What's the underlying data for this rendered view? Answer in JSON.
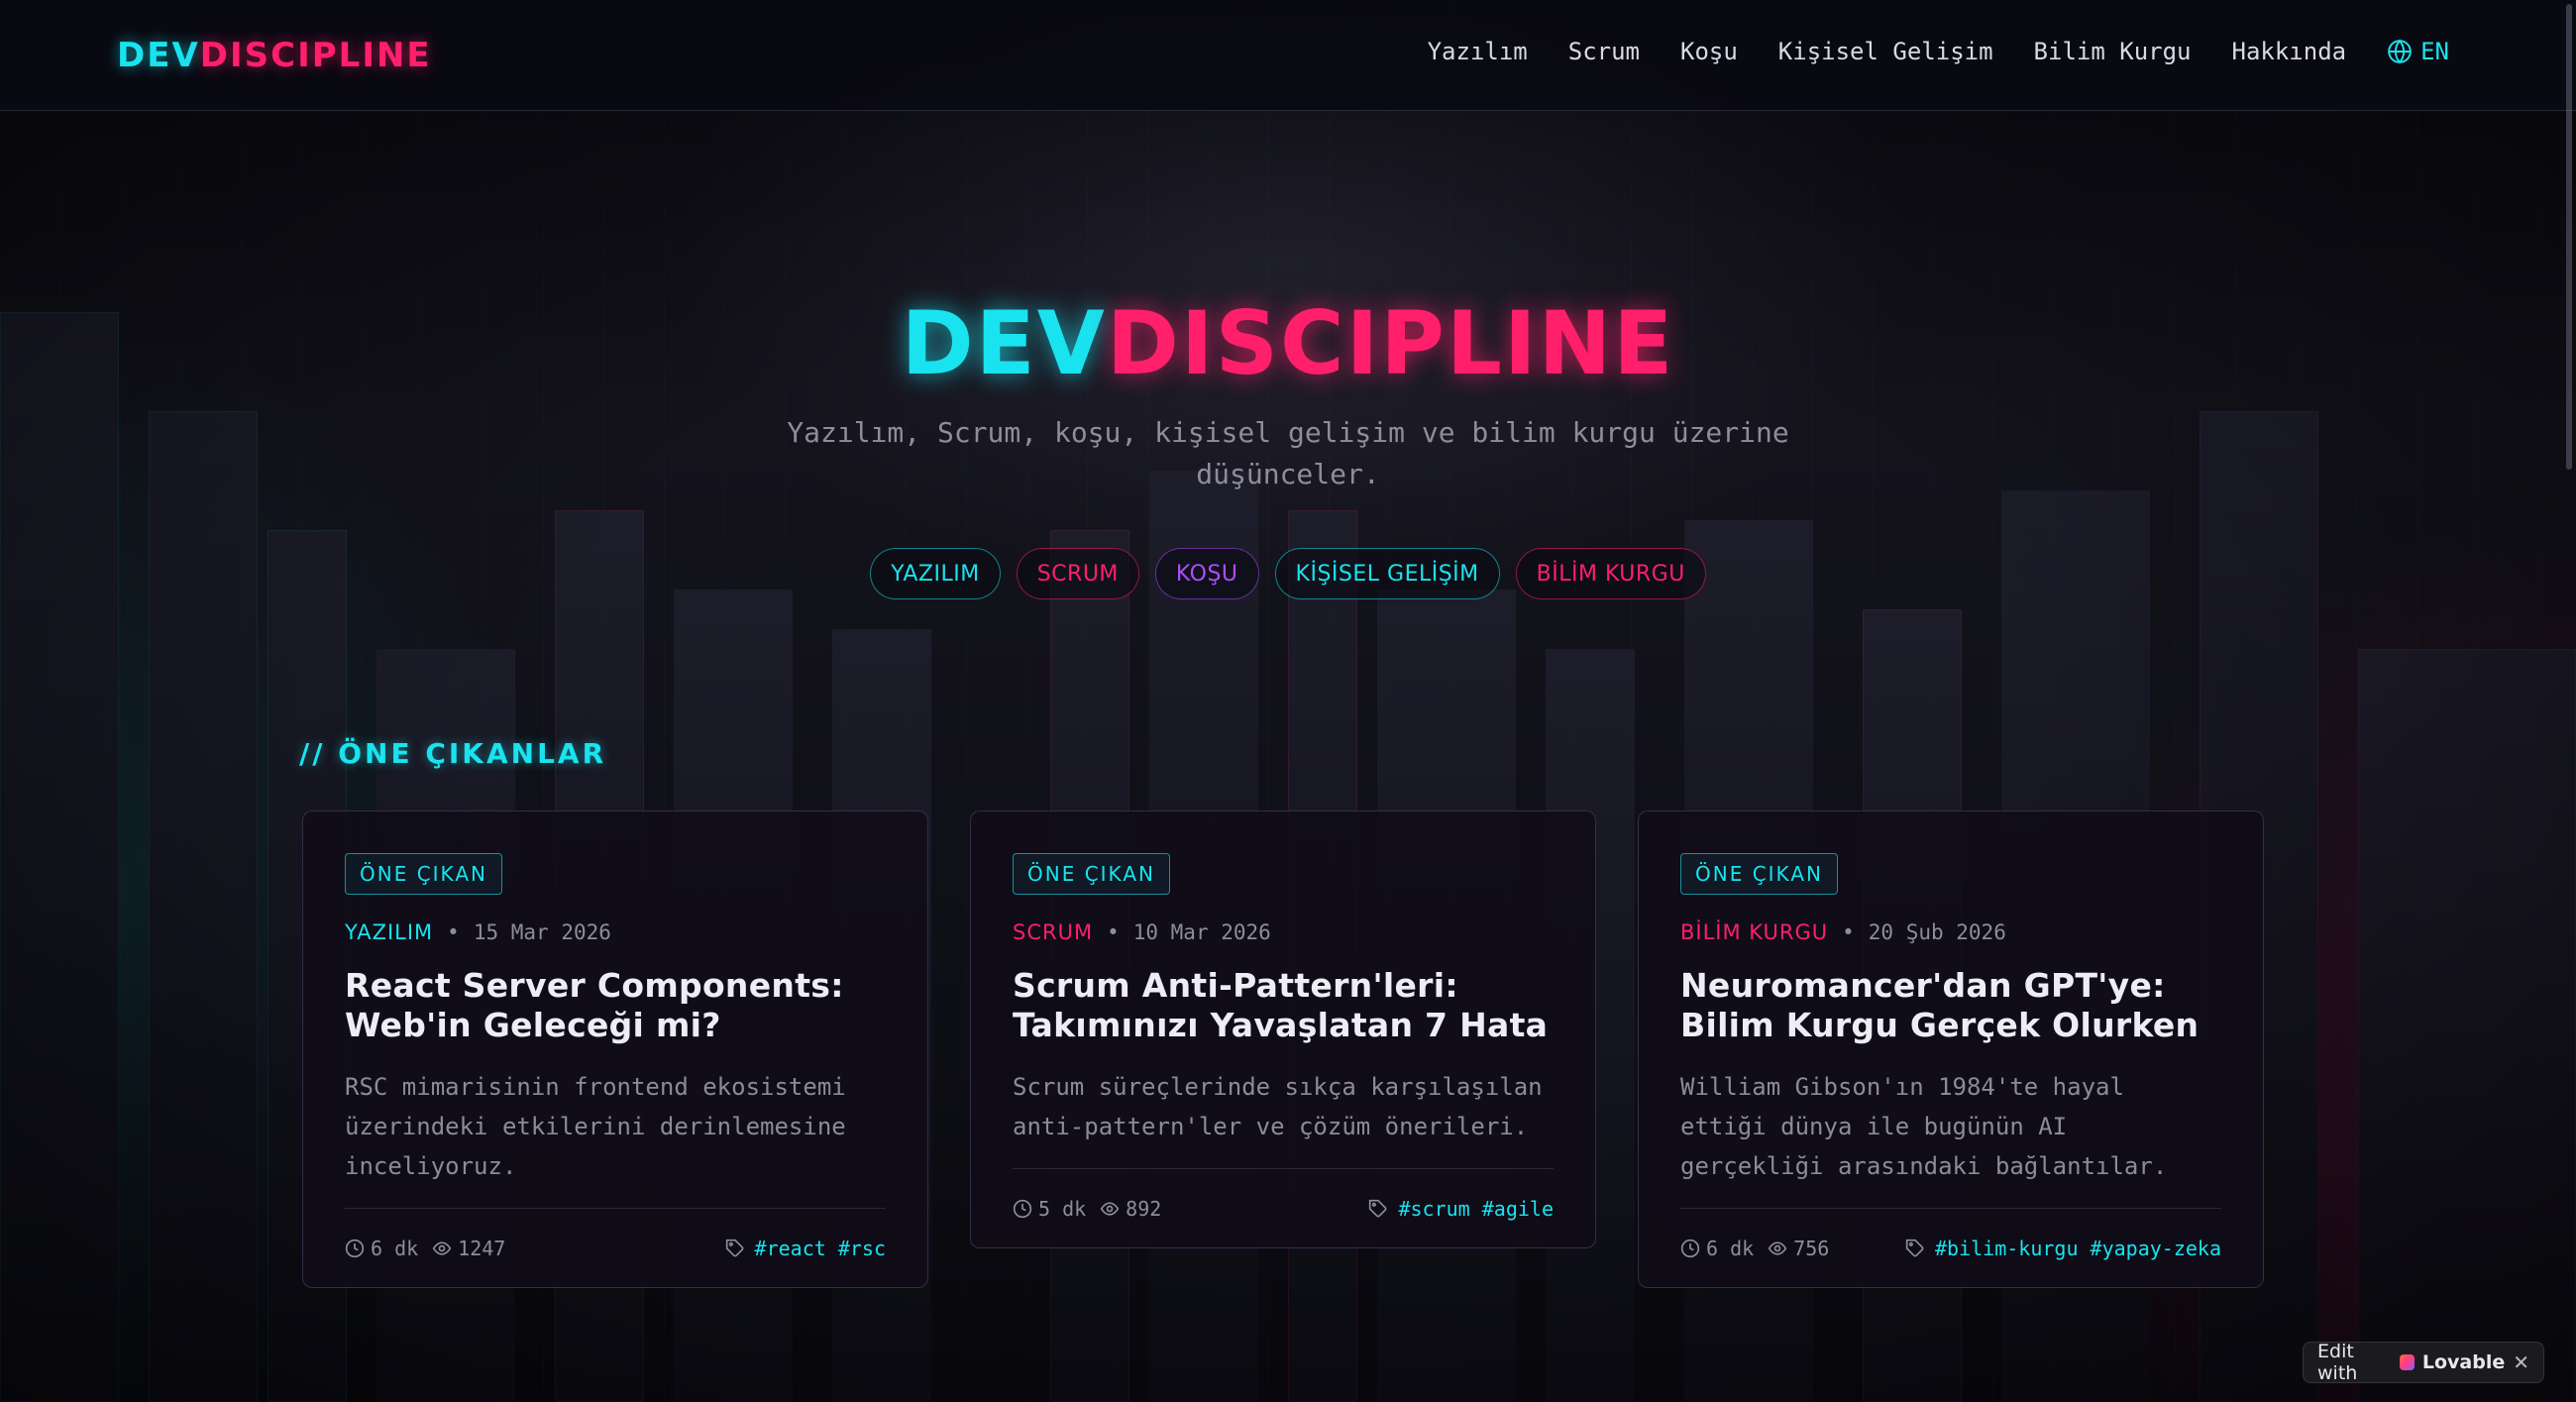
{
  "brand": {
    "part1": "DEV",
    "part2": "DISCIPLINE"
  },
  "nav": {
    "items": [
      "Yazılım",
      "Scrum",
      "Koşu",
      "Kişisel Gelişim",
      "Bilim Kurgu",
      "Hakkında"
    ],
    "language": "EN"
  },
  "hero": {
    "title_part1": "DEV",
    "title_part2": "DISCIPLINE",
    "tagline": "Yazılım, Scrum, koşu, kişisel gelişim ve bilim kurgu üzerine düşünceler."
  },
  "categories": [
    {
      "label": "YAZILIM",
      "color": "#19e3ef"
    },
    {
      "label": "SCRUM",
      "color": "#ff1f6b"
    },
    {
      "label": "KOŞU",
      "color": "#b14bff"
    },
    {
      "label": "KİŞİSEL GELİŞİM",
      "color": "#19e3ef"
    },
    {
      "label": "BİLİM KURGU",
      "color": "#ff1f6b"
    }
  ],
  "featured": {
    "section_title": "// ÖNE ÇIKANLAR",
    "posts": [
      {
        "badge": "ÖNE ÇIKAN",
        "category": "YAZILIM",
        "category_color": "#19e3ef",
        "date": "15 Mar 2026",
        "title": "React Server Components: Web'in Geleceği mi?",
        "excerpt": "RSC mimarisinin frontend ekosistemi üzerindeki etkilerini derinlemesine inceliyoruz.",
        "read_time": "6 dk",
        "views": "1247",
        "tags": "#react #rsc"
      },
      {
        "badge": "ÖNE ÇIKAN",
        "category": "SCRUM",
        "category_color": "#ff1f6b",
        "date": "10 Mar 2026",
        "title": "Scrum Anti-Pattern'leri: Takımınızı Yavaşlatan 7 Hata",
        "excerpt": "Scrum süreçlerinde sıkça karşılaşılan anti-pattern'ler ve çözüm önerileri.",
        "read_time": "5 dk",
        "views": "892",
        "tags": "#scrum #agile"
      },
      {
        "badge": "ÖNE ÇIKAN",
        "category": "BİLİM KURGU",
        "category_color": "#ff1f6b",
        "date": "20 Şub 2026",
        "title": "Neuromancer'dan GPT'ye: Bilim Kurgu Gerçek Olurken",
        "excerpt": "William Gibson'ın 1984'te hayal ettiği dünya ile bugünün AI gerçekliği arasındaki bağlantılar.",
        "read_time": "6 dk",
        "views": "756",
        "tags": "#bilim-kurgu #yapay-zeka"
      }
    ]
  },
  "lovable_badge": {
    "prefix": "Edit with",
    "brand": "Lovable",
    "close": "✕"
  }
}
